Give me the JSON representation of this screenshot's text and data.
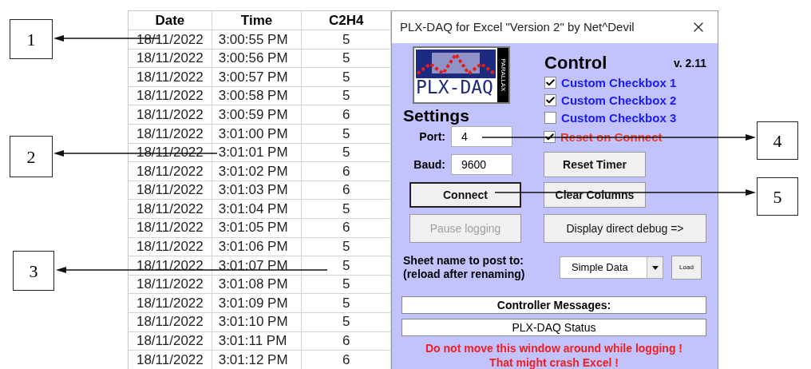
{
  "table": {
    "columns": [
      "Date",
      "Time",
      "C2H4"
    ],
    "rows": [
      [
        "18/11/2022",
        "3:00:55 PM",
        "5"
      ],
      [
        "18/11/2022",
        "3:00:56 PM",
        "5"
      ],
      [
        "18/11/2022",
        "3:00:57 PM",
        "5"
      ],
      [
        "18/11/2022",
        "3:00:58 PM",
        "5"
      ],
      [
        "18/11/2022",
        "3:00:59 PM",
        "6"
      ],
      [
        "18/11/2022",
        "3:01:00 PM",
        "5"
      ],
      [
        "18/11/2022",
        "3:01:01 PM",
        "5"
      ],
      [
        "18/11/2022",
        "3:01:02 PM",
        "6"
      ],
      [
        "18/11/2022",
        "3:01:03 PM",
        "6"
      ],
      [
        "18/11/2022",
        "3:01:04 PM",
        "5"
      ],
      [
        "18/11/2022",
        "3:01:05 PM",
        "6"
      ],
      [
        "18/11/2022",
        "3:01:06 PM",
        "5"
      ],
      [
        "18/11/2022",
        "3:01:07 PM",
        "5"
      ],
      [
        "18/11/2022",
        "3:01:08 PM",
        "5"
      ],
      [
        "18/11/2022",
        "3:01:09 PM",
        "5"
      ],
      [
        "18/11/2022",
        "3:01:10 PM",
        "5"
      ],
      [
        "18/11/2022",
        "3:01:11 PM",
        "6"
      ],
      [
        "18/11/2022",
        "3:01:12 PM",
        "6"
      ]
    ]
  },
  "window": {
    "title": "PLX-DAQ for Excel \"Version 2\" by Net^Devil",
    "logo": {
      "name": "PLX-DAQ",
      "side_text": "PARALLAX"
    },
    "control_heading": "Control",
    "version": "v. 2.11",
    "settings_heading": "Settings",
    "checkboxes": [
      {
        "label": "Custom Checkbox 1",
        "checked": true,
        "color": "#1a1aff"
      },
      {
        "label": "Custom Checkbox 2",
        "checked": true,
        "color": "#1a1aff"
      },
      {
        "label": "Custom Checkbox 3",
        "checked": false,
        "color": "#1a1aff"
      },
      {
        "label": "Reset on Connect",
        "checked": true,
        "color": "#e8402a"
      }
    ],
    "port": {
      "label": "Port:",
      "value": "4"
    },
    "baud": {
      "label": "Baud:",
      "value": "9600"
    },
    "buttons": [
      {
        "label": "Reset Timer",
        "disabled": false,
        "focused": false
      },
      {
        "label": "Connect",
        "disabled": false,
        "focused": true
      },
      {
        "label": "Clear Columns",
        "disabled": false,
        "focused": false
      },
      {
        "label": "Pause logging",
        "disabled": true,
        "focused": false
      },
      {
        "label": "Display direct debug =>",
        "disabled": false,
        "focused": false
      }
    ],
    "sheet": {
      "label": "Sheet name to post to:",
      "note": "(reload after renaming)",
      "value": "Simple Data",
      "load_button": "Load"
    },
    "messages_heading": "Controller Messages:",
    "status": "PLX-DAQ Status",
    "warning": [
      "Do not move this window around while logging !",
      "That might crash Excel !"
    ]
  },
  "callouts": [
    "1",
    "2",
    "3",
    "4",
    "5"
  ]
}
